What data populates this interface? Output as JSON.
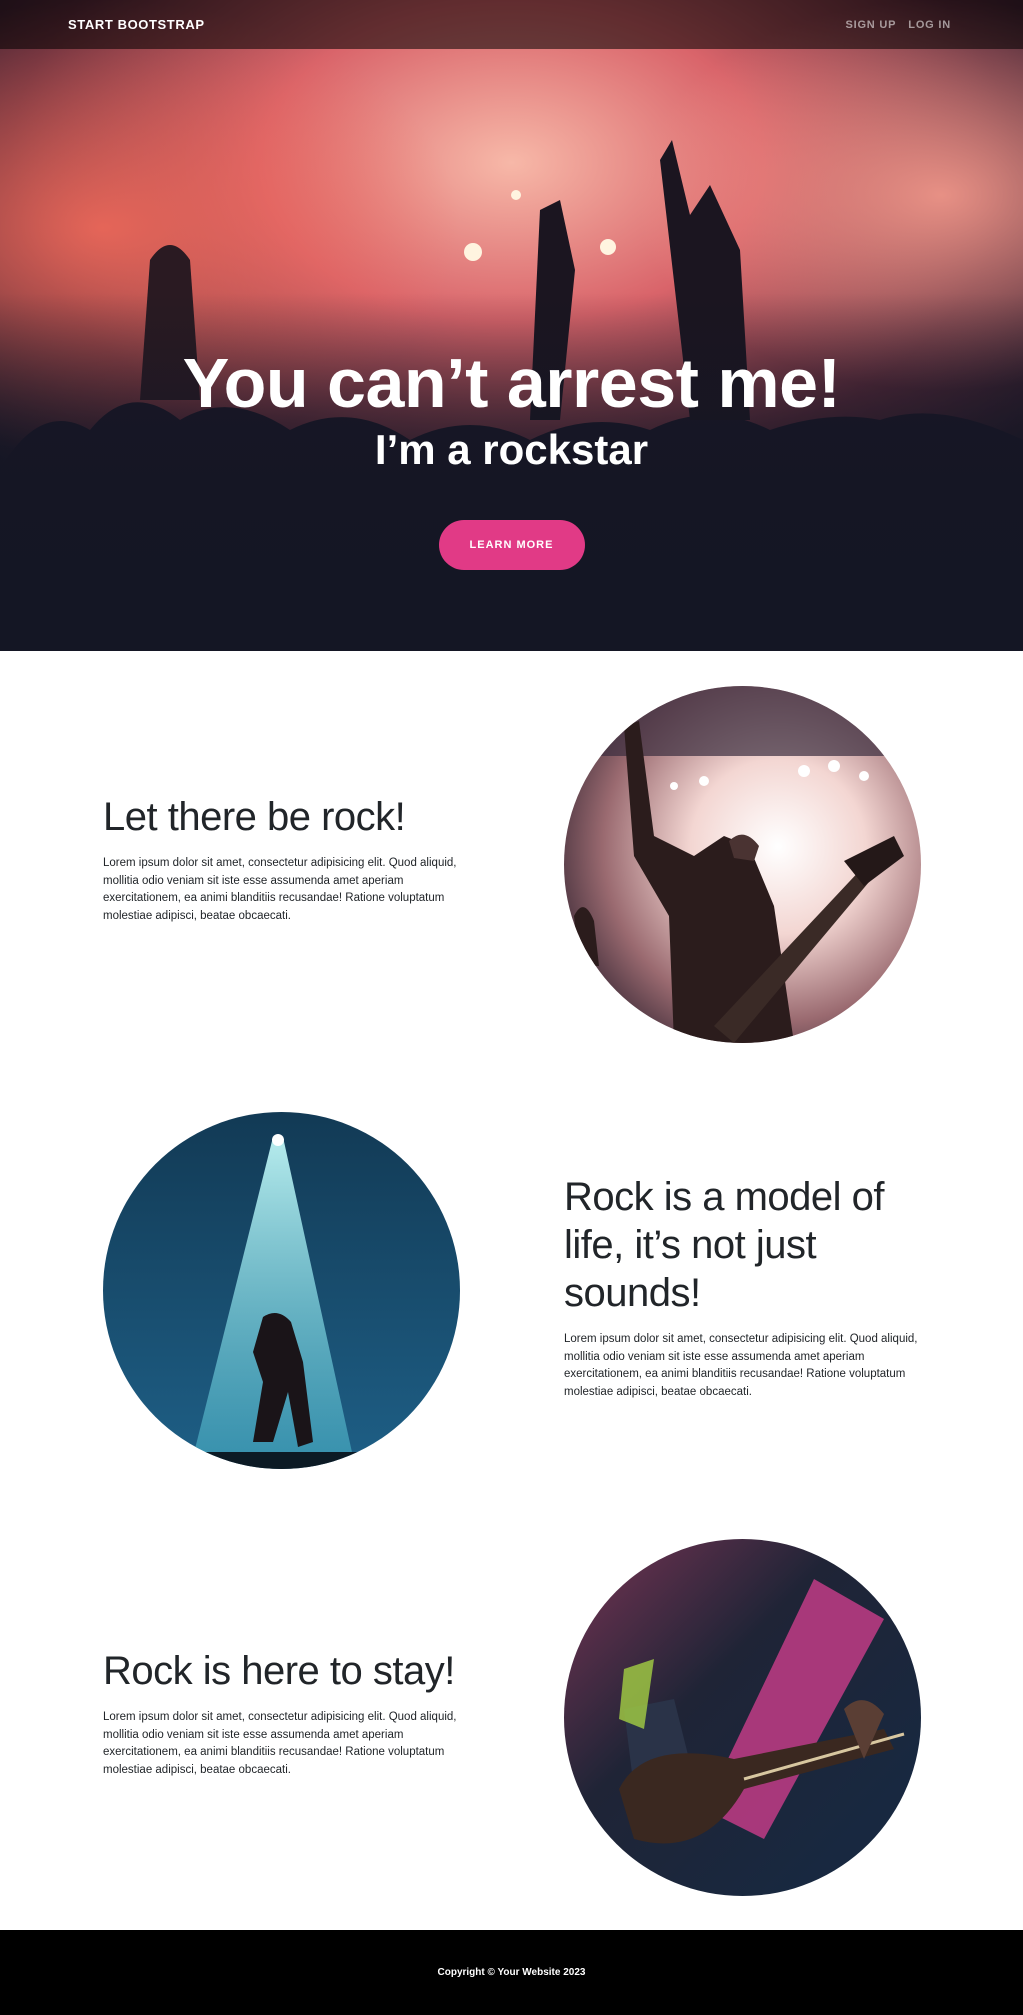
{
  "navbar": {
    "brand": "START BOOTSTRAP",
    "links": [
      "SIGN UP",
      "LOG IN"
    ]
  },
  "hero": {
    "title": "You can’t arrest me!",
    "subtitle": "I’m a rockstar",
    "button": "LEARN MORE"
  },
  "sections": [
    {
      "heading": "Let there be rock!",
      "body": "Lorem ipsum dolor sit amet, consectetur adipisicing elit. Quod aliquid, mollitia odio veniam sit iste esse assumenda amet aperiam exercitationem, ea animi blanditiis recusandae! Ratione voluptatum molestiae adipisci, beatae obcaecati."
    },
    {
      "heading": "Rock is a model of life, it’s not just sounds!",
      "body": "Lorem ipsum dolor sit amet, consectetur adipisicing elit. Quod aliquid, mollitia odio veniam sit iste esse assumenda amet aperiam exercitationem, ea animi blanditiis recusandae! Ratione voluptatum molestiae adipisci, beatae obcaecati."
    },
    {
      "heading": "Rock is here to stay!",
      "body": "Lorem ipsum dolor sit amet, consectetur adipisicing elit. Quod aliquid, mollitia odio veniam sit iste esse assumenda amet aperiam exercitationem, ea animi blanditiis recusandae! Ratione voluptatum molestiae adipisci, beatae obcaecati."
    }
  ],
  "footer": {
    "copyright": "Copyright © Your Website 2023"
  },
  "colors": {
    "accent": "#e13a86",
    "navbar_bg": "#000000",
    "footer_bg": "#000000"
  }
}
